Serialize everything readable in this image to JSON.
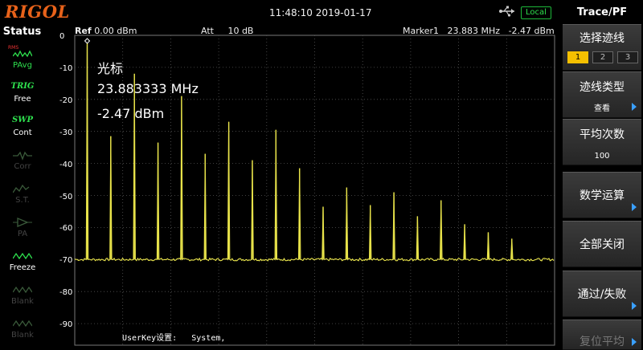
{
  "header": {
    "brand": "RIGOL",
    "datetime": "11:48:10 2019-01-17",
    "connection_badge": "Local",
    "usb_icon": "usb-icon"
  },
  "status_panel": {
    "title": "Status",
    "items": [
      {
        "top": "",
        "label": "PAvg",
        "icon": "trace-avg-icon",
        "active": true
      },
      {
        "top": "TRIG",
        "label": "Free",
        "icon": "",
        "active": true
      },
      {
        "top": "SWP",
        "label": "Cont",
        "icon": "",
        "active": true
      },
      {
        "top": "",
        "label": "Corr",
        "icon": "corr-icon",
        "active": false
      },
      {
        "top": "",
        "label": "S.T.",
        "icon": "source-track-icon",
        "active": false
      },
      {
        "top": "",
        "label": "PA",
        "icon": "preamp-icon",
        "active": false
      },
      {
        "top": "",
        "label": "Freeze",
        "icon": "freeze-icon",
        "active": true
      },
      {
        "top": "",
        "label": "Blank",
        "icon": "blank-icon",
        "active": false
      },
      {
        "top": "",
        "label": "Blank",
        "icon": "blank-icon",
        "active": false
      }
    ],
    "avg_mini_label": "RMS"
  },
  "screen": {
    "ref_label": "Ref",
    "ref_value": "0.00 dBm",
    "att_label": "Att",
    "att_value": "10 dB",
    "marker_label": "Marker1",
    "marker_freq": "23.883 MHz",
    "marker_level": "-2.47 dBm",
    "y_ticks": [
      "0",
      "-10",
      "-20",
      "-30",
      "-40",
      "-50",
      "-60",
      "-70",
      "-80",
      "-90"
    ],
    "marker_info": {
      "title": "光标",
      "freq": "23.883333 MHz",
      "level": "-2.47 dBm"
    },
    "userkey_label": "UserKey设置:",
    "userkey_value": "System,"
  },
  "chart_data": {
    "type": "line",
    "ylim": [
      -95,
      0
    ],
    "grid": true,
    "noise_floor": -70,
    "peaks": [
      {
        "x": 1,
        "y": -2.5
      },
      {
        "x": 2,
        "y": -31.5
      },
      {
        "x": 3,
        "y": -12
      },
      {
        "x": 4,
        "y": -33.5
      },
      {
        "x": 5,
        "y": -19
      },
      {
        "x": 6,
        "y": -37
      },
      {
        "x": 7,
        "y": -27
      },
      {
        "x": 8,
        "y": -39
      },
      {
        "x": 9,
        "y": -29.5
      },
      {
        "x": 10,
        "y": -41.5
      },
      {
        "x": 11,
        "y": -53.5
      },
      {
        "x": 12,
        "y": -47.5
      },
      {
        "x": 13,
        "y": -53
      },
      {
        "x": 14,
        "y": -49
      },
      {
        "x": 15,
        "y": -56.5
      },
      {
        "x": 16,
        "y": -51.5
      },
      {
        "x": 17,
        "y": -59
      },
      {
        "x": 18,
        "y": -61.5
      },
      {
        "x": 19,
        "y": -63.5
      }
    ],
    "trace_color": "#e8e34a"
  },
  "right_panel": {
    "title": "Trace/PF",
    "buttons": [
      {
        "title": "选择迹线",
        "tabs": [
          "1",
          "2",
          "3"
        ],
        "selected_tab": 0
      },
      {
        "title": "迹线类型",
        "sub": "查看",
        "arrow": true
      },
      {
        "title": "平均次数",
        "sub": "100",
        "arrow": false
      },
      {
        "title": "数学运算",
        "sub": "",
        "arrow": true
      },
      {
        "title": "全部关闭",
        "sub": "",
        "arrow": false
      },
      {
        "title": "通过/失败",
        "sub": "",
        "arrow": true
      },
      {
        "title": "复位平均",
        "sub": "",
        "arrow": true,
        "disabled": true
      }
    ]
  }
}
